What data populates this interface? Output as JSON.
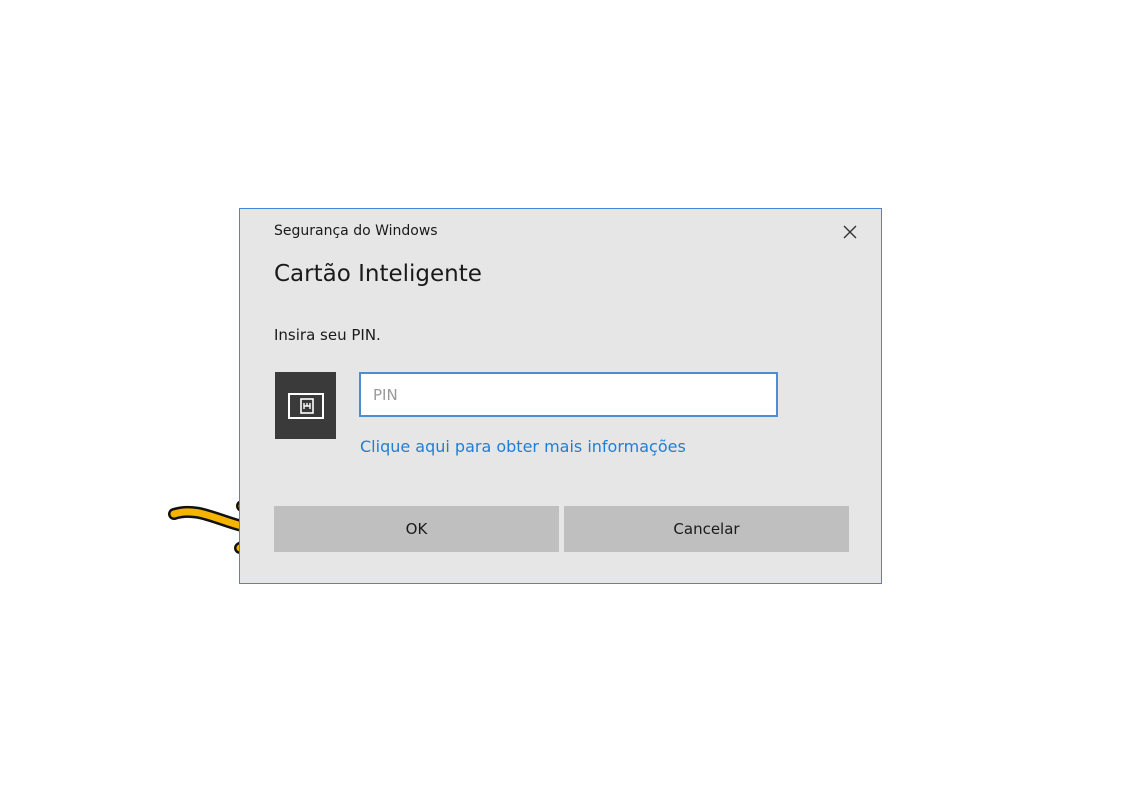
{
  "dialog": {
    "window_title": "Segurança do Windows",
    "heading": "Cartão Inteligente",
    "prompt": "Insira seu PIN.",
    "pin_input": {
      "value": "",
      "placeholder": "PIN"
    },
    "info_link": "Clique aqui para obter mais informações",
    "ok_label": "OK",
    "cancel_label": "Cancelar"
  },
  "icons": {
    "close": "close-icon",
    "card": "smart-card-icon",
    "pointer": "pointer-arrow-icon"
  },
  "colors": {
    "dialog_border": "#3c8ad8",
    "dialog_background": "#e6e6e6",
    "input_border": "#4a8fd6",
    "link": "#1f7ed6",
    "button": "#bfbfbf",
    "card_tile": "#3a3a3a",
    "arrow": "#f4b400"
  }
}
